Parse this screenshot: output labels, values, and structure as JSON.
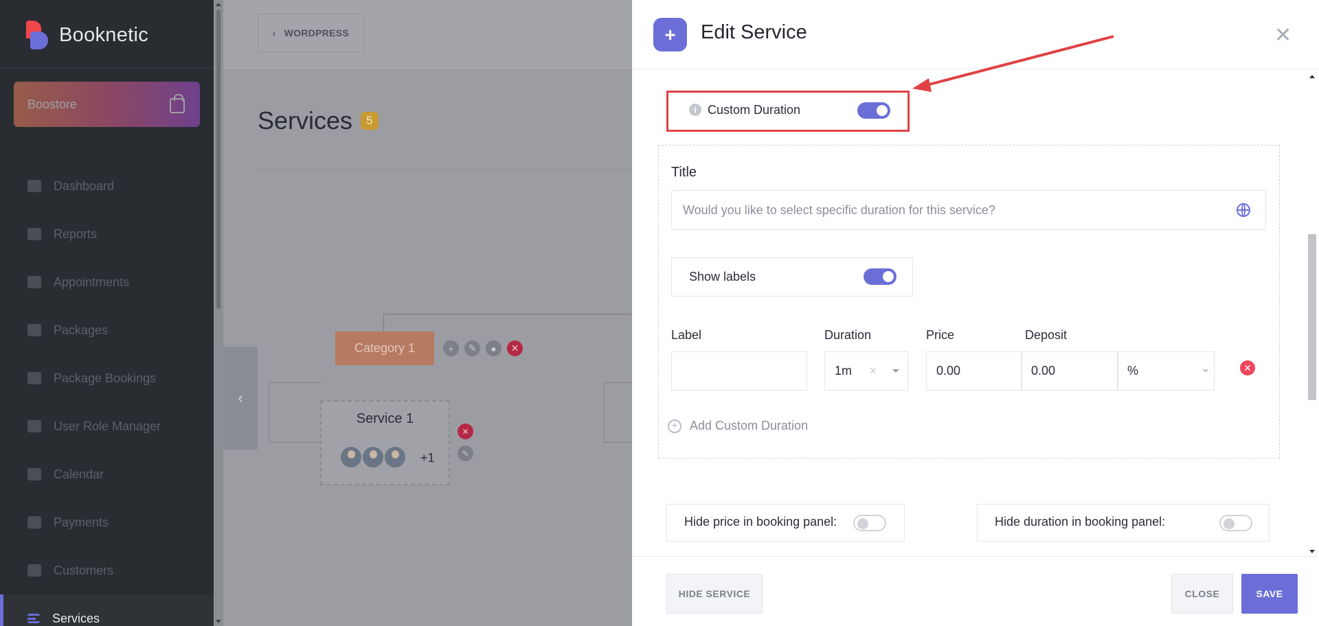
{
  "sidebar": {
    "brand": "Booknetic",
    "boostore": "Boostore",
    "items": [
      {
        "label": "Dashboard"
      },
      {
        "label": "Reports"
      },
      {
        "label": "Appointments"
      },
      {
        "label": "Packages"
      },
      {
        "label": "Package Bookings"
      },
      {
        "label": "User Role Manager"
      },
      {
        "label": "Calendar"
      },
      {
        "label": "Payments"
      },
      {
        "label": "Customers"
      },
      {
        "label": "Services"
      }
    ]
  },
  "main": {
    "back_label": "WORDPRESS",
    "page_title": "Services",
    "count": "5",
    "category": "Category 1",
    "service_title": "Service 1",
    "more_staff": "+1"
  },
  "modal": {
    "title": "Edit Service",
    "custom_duration_label": "Custom Duration",
    "title_label": "Title",
    "title_value": "Would you like to select specific duration for this service?",
    "show_labels": "Show labels",
    "columns": {
      "label": "Label",
      "duration": "Duration",
      "price": "Price",
      "deposit": "Deposit"
    },
    "row": {
      "label": "",
      "duration": "1m",
      "price": "0.00",
      "deposit": "0.00",
      "deposit_type": "%"
    },
    "add_custom_duration": "Add Custom Duration",
    "hide_price": "Hide price in booking panel:",
    "hide_duration": "Hide duration in booking panel:",
    "hide_service_btn": "HIDE SERVICE",
    "close_btn": "CLOSE",
    "save_btn": "SAVE"
  },
  "colors": {
    "accent": "#6c6ed8",
    "annotation": "#e04145",
    "danger": "#f0455a"
  }
}
